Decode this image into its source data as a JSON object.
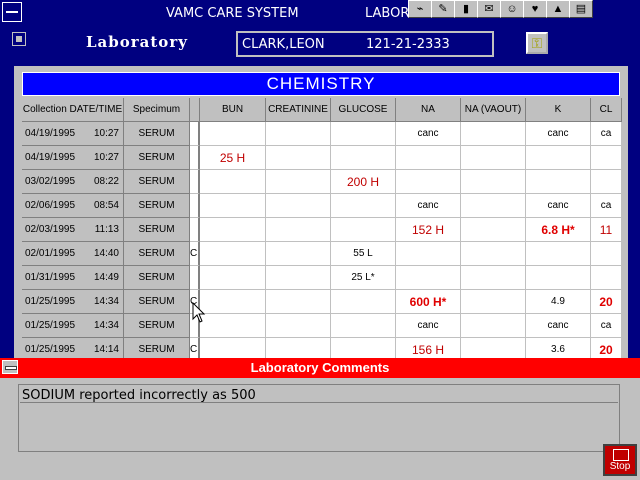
{
  "window": {
    "title_left": "VAMC CARE SYSTEM",
    "title_right": "LABOR"
  },
  "toolbar": {
    "icons": [
      "chart-icon",
      "notes-icon",
      "medicine-icon",
      "mail-icon",
      "people-icon",
      "ekg-icon",
      "radiology-icon",
      "form-icon"
    ],
    "glyphs": [
      "⌁",
      "✎",
      "▮",
      "✉",
      "☺",
      "♥",
      "▲",
      "▤"
    ]
  },
  "header": {
    "label": "Laboratory",
    "patient_name": "CLARK,LEON",
    "patient_ssn": "121-21-2333"
  },
  "chemistry": {
    "title": "CHEMISTRY",
    "columns": {
      "collection": "Collection DATE/TIME",
      "specimen": "Specimum",
      "tests": [
        "BUN",
        "CREATININE",
        "GLUCOSE",
        "NA",
        "NA (VAOUT)",
        "K",
        "CL"
      ]
    },
    "rows": [
      {
        "date": "04/19/1995",
        "time": "10:27",
        "specimen": "SERUM",
        "flag": "",
        "values": [
          "",
          "",
          "",
          "canc",
          "",
          "canc",
          "ca"
        ]
      },
      {
        "date": "04/19/1995",
        "time": "10:27",
        "specimen": "SERUM",
        "flag": "",
        "values": [
          "25 H",
          "",
          "",
          "",
          "",
          "",
          ""
        ]
      },
      {
        "date": "03/02/1995",
        "time": "08:22",
        "specimen": "SERUM",
        "flag": "",
        "values": [
          "",
          "",
          "200 H",
          "",
          "",
          "",
          ""
        ]
      },
      {
        "date": "02/06/1995",
        "time": "08:54",
        "specimen": "SERUM",
        "flag": "",
        "values": [
          "",
          "",
          "",
          "canc",
          "",
          "canc",
          "ca"
        ]
      },
      {
        "date": "02/03/1995",
        "time": "11:13",
        "specimen": "SERUM",
        "flag": "",
        "values": [
          "",
          "",
          "",
          "152 H",
          "",
          "6.8 H*",
          "11"
        ]
      },
      {
        "date": "02/01/1995",
        "time": "14:40",
        "specimen": "SERUM",
        "flag": "C",
        "values": [
          "",
          "",
          "55 L",
          "",
          "",
          "",
          ""
        ]
      },
      {
        "date": "01/31/1995",
        "time": "14:49",
        "specimen": "SERUM",
        "flag": "",
        "values": [
          "",
          "",
          "25 L*",
          "",
          "",
          "",
          ""
        ]
      },
      {
        "date": "01/25/1995",
        "time": "14:34",
        "specimen": "SERUM",
        "flag": "C",
        "values": [
          "",
          "",
          "",
          "600 H*",
          "",
          "4.9",
          "20"
        ]
      },
      {
        "date": "01/25/1995",
        "time": "14:34",
        "specimen": "SERUM",
        "flag": "",
        "values": [
          "",
          "",
          "",
          "canc",
          "",
          "canc",
          "ca"
        ]
      },
      {
        "date": "01/25/1995",
        "time": "14:14",
        "specimen": "SERUM",
        "flag": "C",
        "values": [
          "",
          "",
          "",
          "156 H",
          "",
          "3.6",
          "20"
        ]
      }
    ],
    "styles": [
      [
        "",
        "",
        "",
        "n",
        "",
        "n",
        "n"
      ],
      [
        "r",
        "",
        "",
        "",
        "",
        "",
        ""
      ],
      [
        "",
        "",
        "r",
        "",
        "",
        "",
        ""
      ],
      [
        "",
        "",
        "",
        "n",
        "",
        "n",
        "n"
      ],
      [
        "",
        "",
        "",
        "r",
        "",
        "rb",
        "r"
      ],
      [
        "",
        "",
        "n",
        "",
        "",
        "",
        ""
      ],
      [
        "",
        "",
        "n",
        "",
        "",
        "",
        ""
      ],
      [
        "",
        "",
        "",
        "rb",
        "",
        "n",
        "rb"
      ],
      [
        "",
        "",
        "",
        "n",
        "",
        "n",
        "n"
      ],
      [
        "",
        "",
        "",
        "r",
        "",
        "n",
        "rb"
      ]
    ]
  },
  "comments": {
    "title": "Laboratory Comments",
    "text": "SODIUM reported incorrectly as 500"
  },
  "stop_button": {
    "label": "Stop"
  }
}
